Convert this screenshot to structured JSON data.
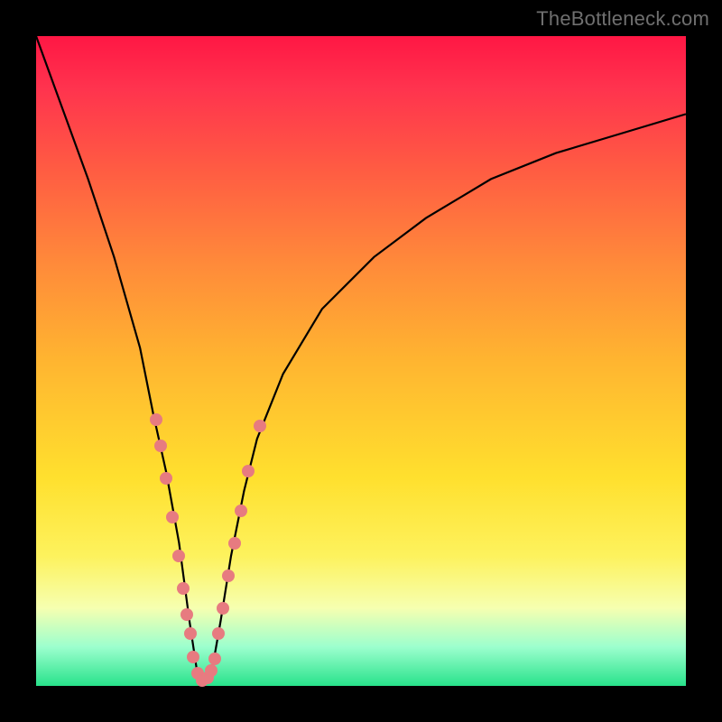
{
  "watermark": {
    "text": "TheBottleneck.com"
  },
  "colors": {
    "frame": "#000000",
    "curve_stroke": "#000000",
    "dot_fill": "#e77b80",
    "gradient_top": "#ff1744",
    "gradient_bottom": "#28e28b"
  },
  "chart_data": {
    "type": "line",
    "title": "",
    "xlabel": "",
    "ylabel": "",
    "xlim": [
      0,
      100
    ],
    "ylim": [
      0,
      100
    ],
    "grid": false,
    "legend": false,
    "series": [
      {
        "name": "bottleneck-curve",
        "x": [
          0,
          4,
          8,
          12,
          16,
          18,
          20,
          22,
          23.6,
          24.8,
          26,
          27,
          28.4,
          30,
          32,
          34,
          38,
          44,
          52,
          60,
          70,
          80,
          90,
          100
        ],
        "y": [
          100,
          89,
          78,
          66,
          52,
          42,
          33,
          22,
          10,
          2,
          0.5,
          2,
          10,
          20,
          30,
          38,
          48,
          58,
          66,
          72,
          78,
          82,
          85,
          88
        ]
      }
    ],
    "dots_left": [
      {
        "x": 18.5,
        "y": 41
      },
      {
        "x": 19.2,
        "y": 37
      },
      {
        "x": 20.0,
        "y": 32
      },
      {
        "x": 21.0,
        "y": 26
      },
      {
        "x": 22.0,
        "y": 20
      },
      {
        "x": 22.6,
        "y": 15
      },
      {
        "x": 23.2,
        "y": 11
      },
      {
        "x": 23.7,
        "y": 8
      },
      {
        "x": 24.2,
        "y": 4.5
      },
      {
        "x": 24.8,
        "y": 2
      },
      {
        "x": 25.5,
        "y": 0.9
      }
    ],
    "dots_right": [
      {
        "x": 26.4,
        "y": 1.2
      },
      {
        "x": 27.0,
        "y": 2.4
      },
      {
        "x": 27.5,
        "y": 4.2
      },
      {
        "x": 28.1,
        "y": 8
      },
      {
        "x": 28.8,
        "y": 12
      },
      {
        "x": 29.6,
        "y": 17
      },
      {
        "x": 30.5,
        "y": 22
      },
      {
        "x": 31.5,
        "y": 27
      },
      {
        "x": 32.6,
        "y": 33
      },
      {
        "x": 34.5,
        "y": 40
      }
    ]
  }
}
